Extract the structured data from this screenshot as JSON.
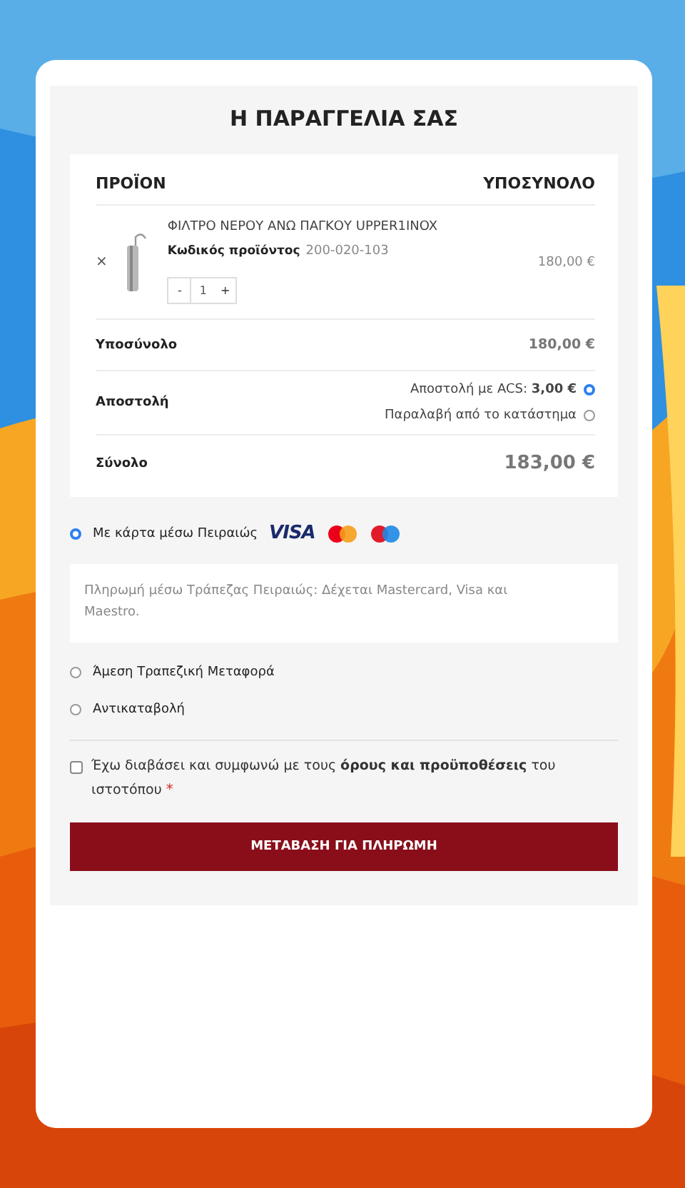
{
  "title": "Η ΠΑΡΑΓΓΕΛΙΑ ΣΑΣ",
  "table": {
    "columns": [
      "ΠΡΟΪΟΝ",
      "ΥΠΟΣΥΝΟΛΟ"
    ],
    "item": {
      "remove": "×",
      "name": "ΦΙΛΤΡΟ ΝΕΡΟΥ ΑΝΩ ΠΑΓΚΟΥ UPPER1INOX",
      "sku_label": "Κωδικός προϊόντος",
      "sku": "200-020-103",
      "minus": "-",
      "quantity": "1",
      "plus": "+",
      "subtotal": "180,00 €"
    },
    "subtotal": {
      "label": "Υποσύνολο",
      "value": "180,00 €"
    },
    "shipping": {
      "label": "Αποστολή",
      "options": [
        {
          "label": "Αποστολή με ACS: **3,00 €**",
          "selected": true
        },
        {
          "label": "Παραλαβή από το κατάστημα",
          "selected": false
        }
      ]
    },
    "total": {
      "label": "Σύνολο",
      "value": "183,00 €"
    }
  },
  "payments": [
    {
      "label": "Με κάρτα μέσω Πειραιώς",
      "selected": true,
      "logos": [
        {
          "kind": "visa",
          "text": "VISA"
        },
        {
          "kind": "mastercard"
        },
        {
          "kind": "maestro"
        }
      ],
      "description": "Πληρωμή μέσω Τράπεζας Πειραιώς: Δέχεται Mastercard, Visa και Maestro."
    },
    {
      "label": "Άμεση Τραπεζική Μεταφορά",
      "selected": false
    },
    {
      "label": "Αντικαταβολή",
      "selected": false
    }
  ],
  "terms": {
    "text": "Έχω διαβάσει και συμφωνώ με τους **όρους και προϋποθέσεις** του ιστοτόπου",
    "required": "*",
    "checked": false
  },
  "submit": "ΜΕΤΑΒΑΣΗ ΓΙΑ ΠΛΗΡΩΜΗ"
}
